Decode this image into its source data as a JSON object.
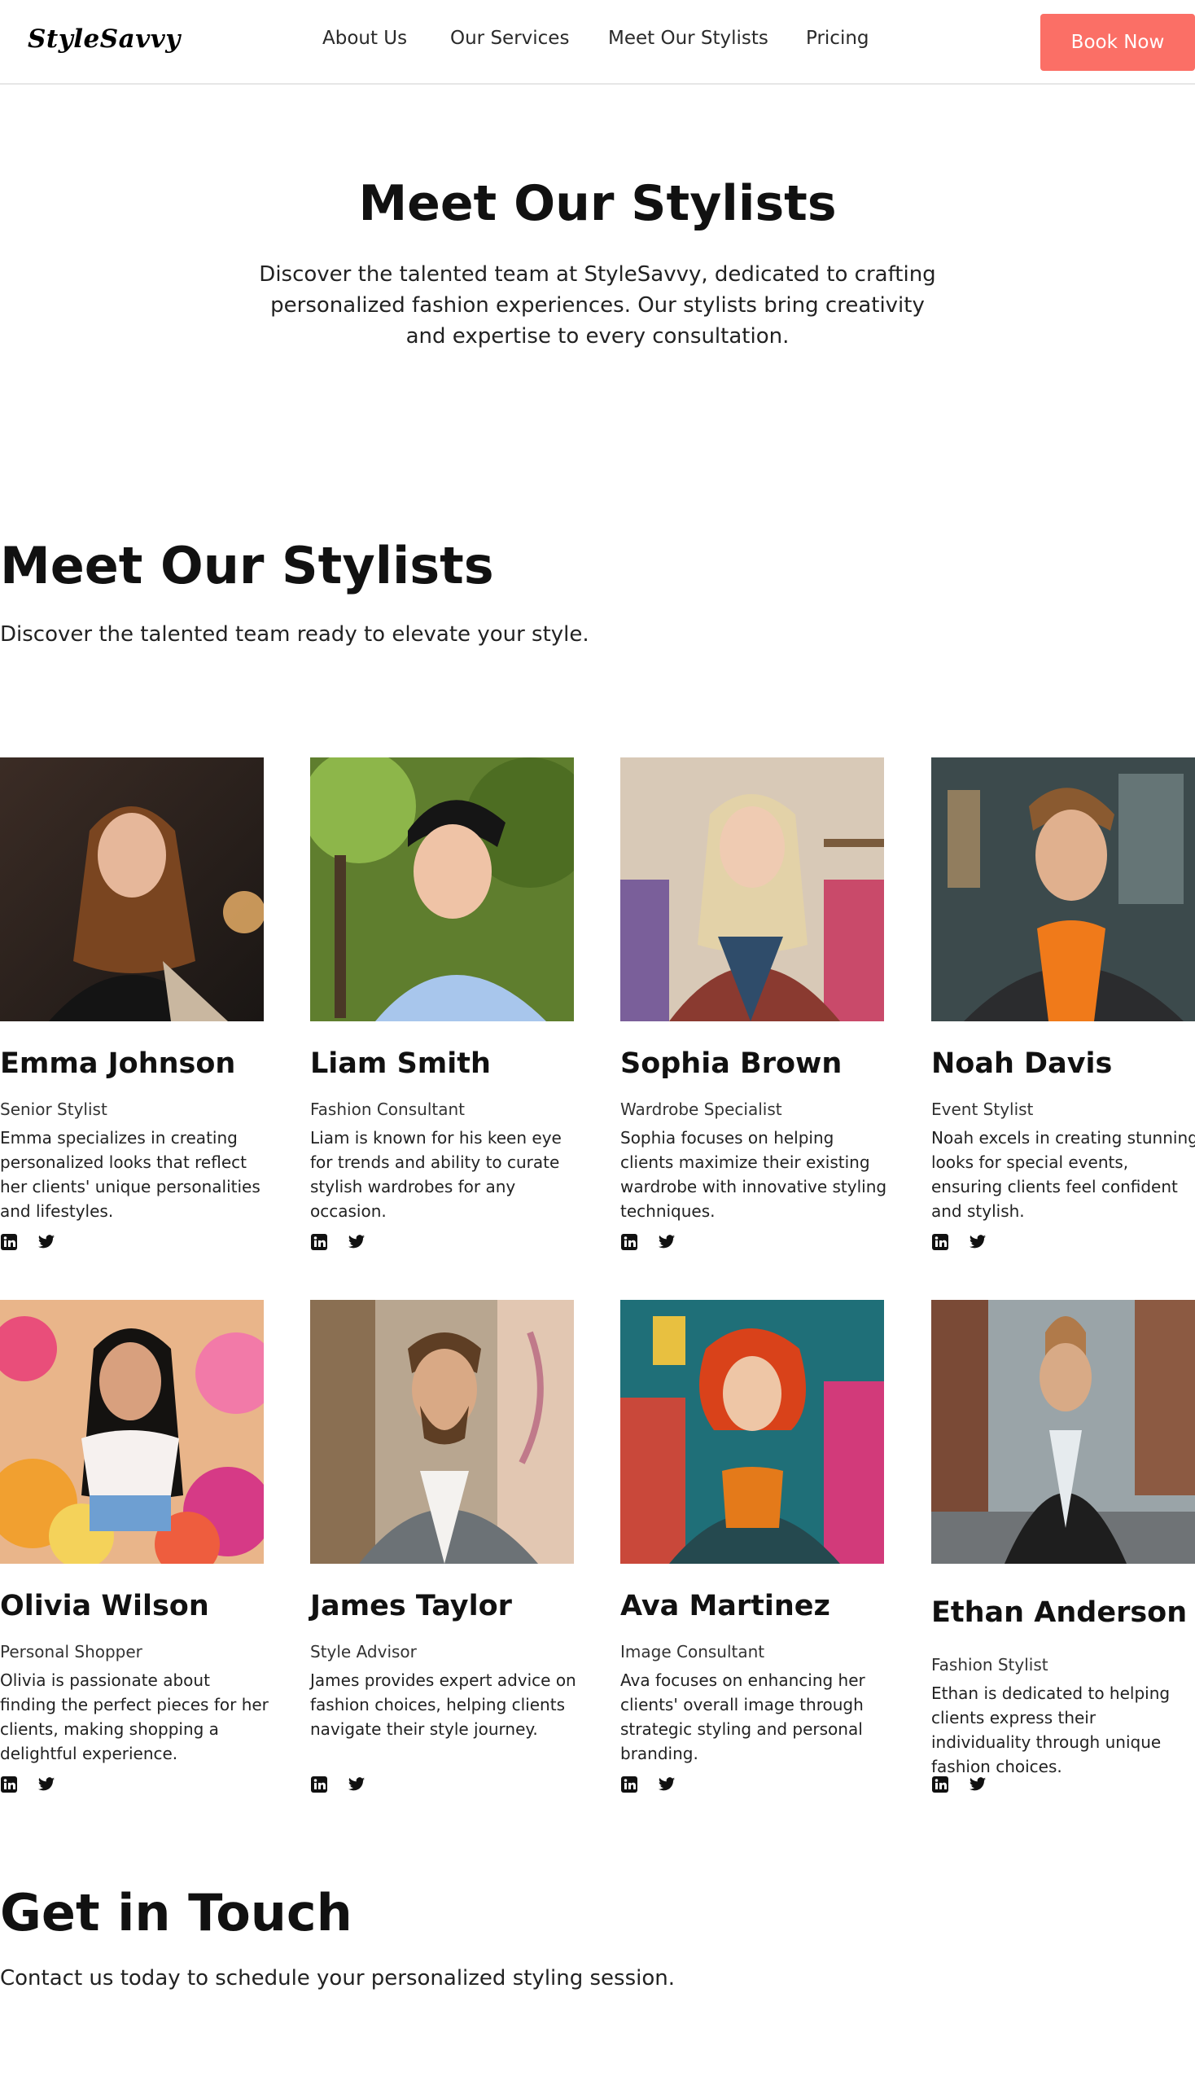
{
  "brand": {
    "logo": "StyleSavvy"
  },
  "nav": {
    "items": [
      "About Us",
      "Our Services",
      "Meet Our Stylists",
      "Pricing"
    ],
    "cta": "Book Now"
  },
  "hero": {
    "title": "Meet Our Stylists",
    "text": "Discover the talented team at StyleSavvy, dedicated to crafting personalized fashion experiences. Our stylists bring creativity and expertise to every consultation."
  },
  "team": {
    "title": "Meet Our Stylists",
    "subtitle": "Discover the talented team ready to elevate your style.",
    "members": [
      {
        "name": "Emma Johnson",
        "role": "Senior Stylist",
        "bio": "Emma specializes in creating personalized looks that reflect her clients' unique personalities and lifestyles."
      },
      {
        "name": "Liam Smith",
        "role": "Fashion Consultant",
        "bio": "Liam is known for his keen eye for trends and ability to curate stylish wardrobes for any occasion."
      },
      {
        "name": "Sophia Brown",
        "role": "Wardrobe Specialist",
        "bio": "Sophia focuses on helping clients maximize their existing wardrobe with innovative styling techniques."
      },
      {
        "name": "Noah Davis",
        "role": "Event Stylist",
        "bio": "Noah excels in creating stunning looks for special events, ensuring clients feel confident and stylish."
      },
      {
        "name": "Olivia Wilson",
        "role": "Personal Shopper",
        "bio": "Olivia is passionate about finding the perfect pieces for her clients, making shopping a delightful experience."
      },
      {
        "name": "James Taylor",
        "role": "Style Advisor",
        "bio": "James provides expert advice on fashion choices, helping clients navigate their style journey."
      },
      {
        "name": "Ava Martinez",
        "role": "Image Consultant",
        "bio": "Ava focuses on enhancing her clients' overall image through strategic styling and personal branding."
      },
      {
        "name": "Ethan Anderson",
        "role": "Fashion Stylist",
        "bio": "Ethan is dedicated to helping clients express their individuality through unique fashion choices."
      }
    ]
  },
  "contact": {
    "title": "Get in Touch",
    "text": "Contact us today to schedule your personalized styling session."
  },
  "colors": {
    "accent": "#fb6f66",
    "text": "#111111"
  },
  "icons": [
    "linkedin-icon",
    "twitter-icon"
  ]
}
